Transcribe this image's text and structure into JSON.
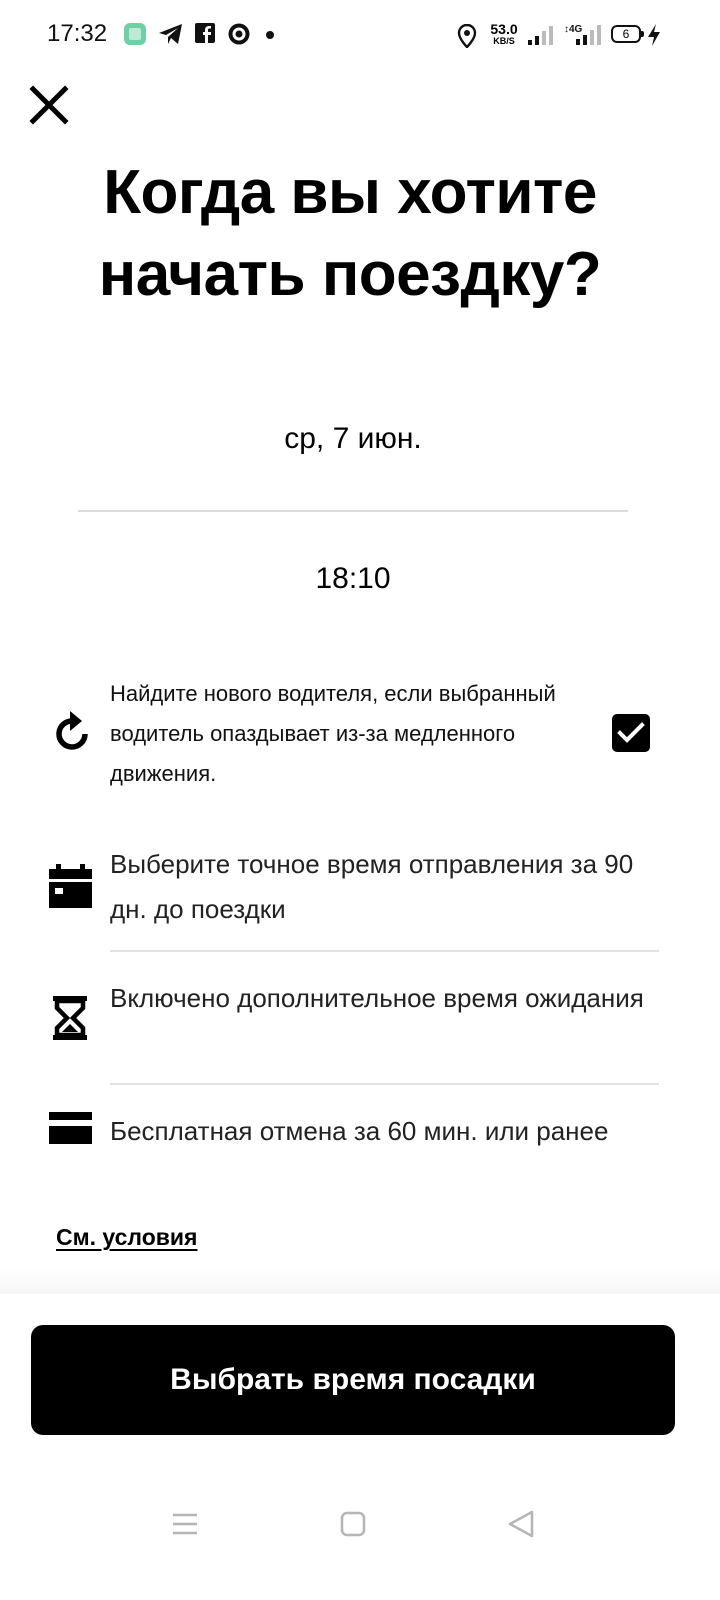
{
  "status_bar": {
    "time": "17:32",
    "network_speed_value": "53.0",
    "network_speed_unit": "KB/S",
    "network_type": "4G",
    "battery_level": "6",
    "icons": [
      "app-notification-icon",
      "telegram-icon",
      "facebook-icon",
      "app-icon",
      "more-notifications-dot",
      "location-icon",
      "signal-icon",
      "signal-4g-icon",
      "battery-icon",
      "charging-icon"
    ]
  },
  "header": {
    "close_icon": "close-icon"
  },
  "title_line1": "Когда вы хотите",
  "title_line2": "начать поездку?",
  "picker": {
    "date": "ср, 7 июн.",
    "time": "18:10"
  },
  "option": {
    "icon": "refresh-icon",
    "text": "Найдите нового водителя, если выбранный водитель опаздывает из-за медленного движения.",
    "checked": true
  },
  "features": [
    {
      "icon": "calendar-icon",
      "text": "Выберите точное время отправления за 90 дн. до поездки"
    },
    {
      "icon": "hourglass-icon",
      "text": "Включено дополнительное время ожидания"
    },
    {
      "icon": "card-icon",
      "text": "Бесплатная отмена за 60 мин. или ранее"
    }
  ],
  "terms_link": "См. условия",
  "cta_label": "Выбрать время посадки",
  "nav_bar": [
    "menu-nav-icon",
    "home-nav-icon",
    "back-nav-icon"
  ],
  "colors": {
    "background": "#ffffff",
    "text": "#000000",
    "button": "#000000",
    "button_text": "#ffffff",
    "divider": "#dcdcdc",
    "app_icon_green": "#6fcfa5"
  }
}
